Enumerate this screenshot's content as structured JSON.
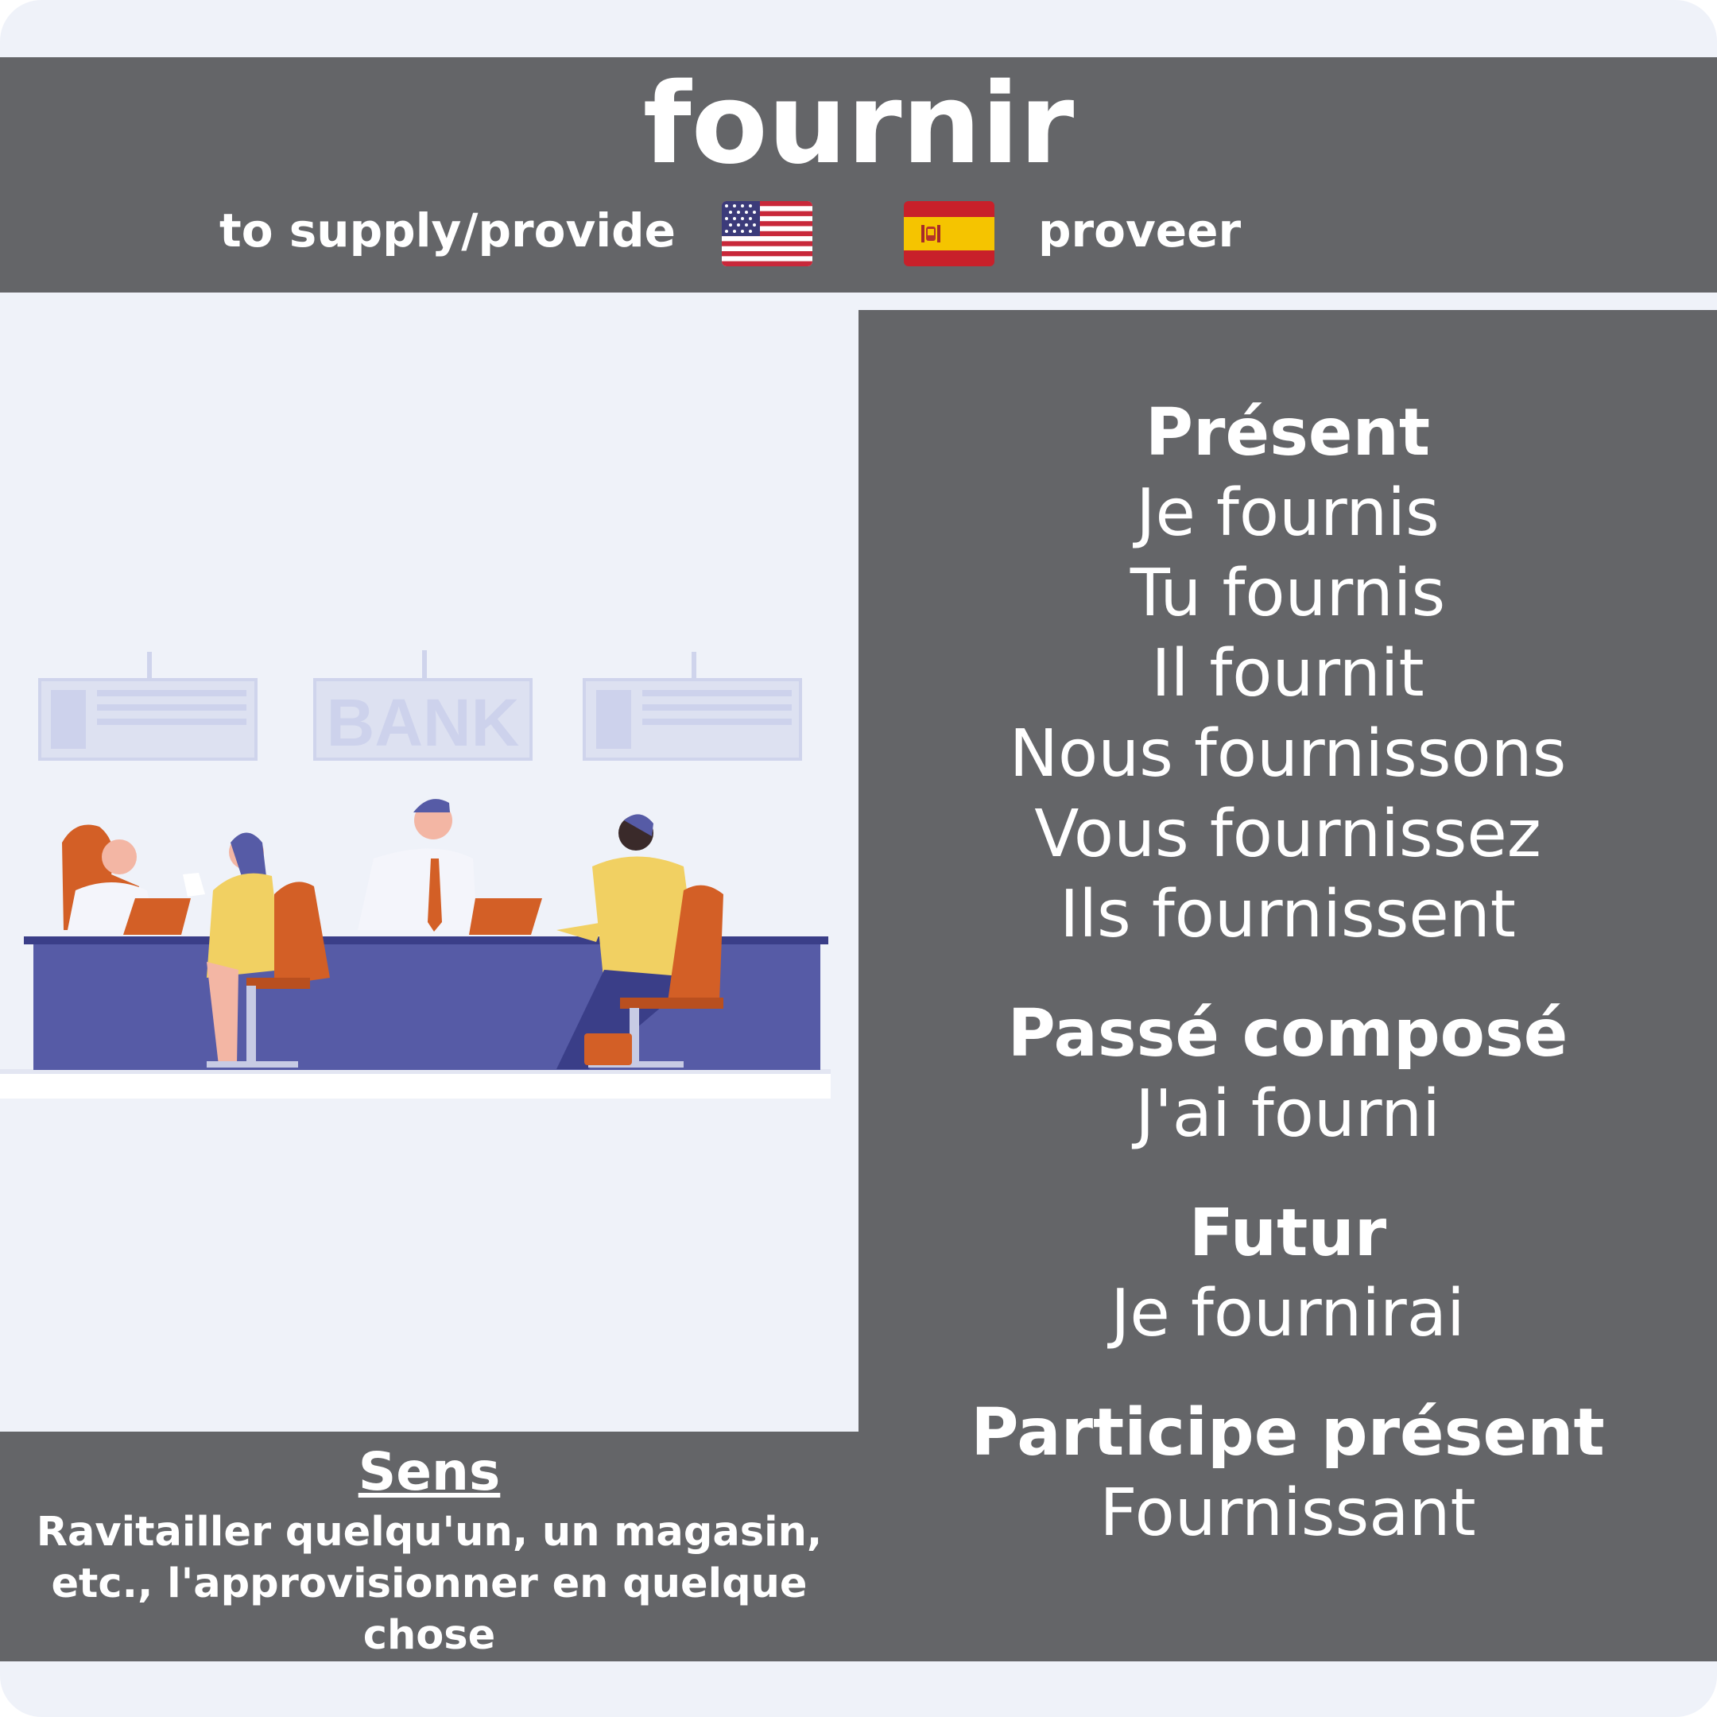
{
  "header": {
    "verb": "fournir",
    "english": "to supply/provide",
    "spanish": "proveer",
    "us_flag_icon": "us-flag",
    "es_flag_icon": "spain-flag"
  },
  "illustration": {
    "sign_text": "BANK"
  },
  "conjugation": {
    "present": {
      "label": "Présent",
      "forms": [
        "Je fournis",
        "Tu fournis",
        "Il fournit",
        "Nous fournissons",
        "Vous fournissez",
        "Ils fournissent"
      ]
    },
    "passe_compose": {
      "label": "Passé composé",
      "form": "J'ai fourni"
    },
    "futur": {
      "label": "Futur",
      "form": "Je fournirai"
    },
    "participe_present": {
      "label": "Participe présent",
      "form": "Fournissant"
    }
  },
  "meaning": {
    "title": "Sens",
    "text": "Ravitailler quelqu'un, un magasin, etc., l'approvisionner en quelque chose"
  },
  "colors": {
    "panel": "#646568",
    "background": "#eff2f9",
    "desk": "#565ba6",
    "accent_orange": "#d35f26",
    "accent_yellow": "#f1d062"
  }
}
